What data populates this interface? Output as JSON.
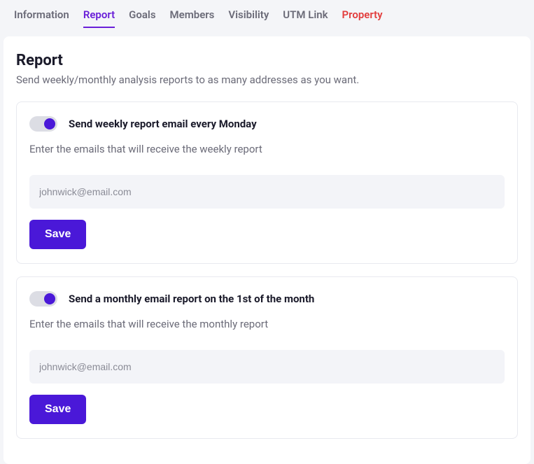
{
  "tabs": {
    "information": "Information",
    "report": "Report",
    "goals": "Goals",
    "members": "Members",
    "visibility": "Visibility",
    "utm_link": "UTM Link",
    "property": "Property"
  },
  "page": {
    "title": "Report",
    "subtitle": "Send weekly/monthly analysis reports to as many addresses as you want."
  },
  "weekly": {
    "toggle_label": "Send weekly report email every Monday",
    "helper": "Enter the emails that will receive the weekly report",
    "placeholder": "johnwick@email.com",
    "save_label": "Save"
  },
  "monthly": {
    "toggle_label": "Send a monthly email report on the 1st of the month",
    "helper": "Enter the emails that will receive the monthly report",
    "placeholder": "johnwick@email.com",
    "save_label": "Save"
  }
}
